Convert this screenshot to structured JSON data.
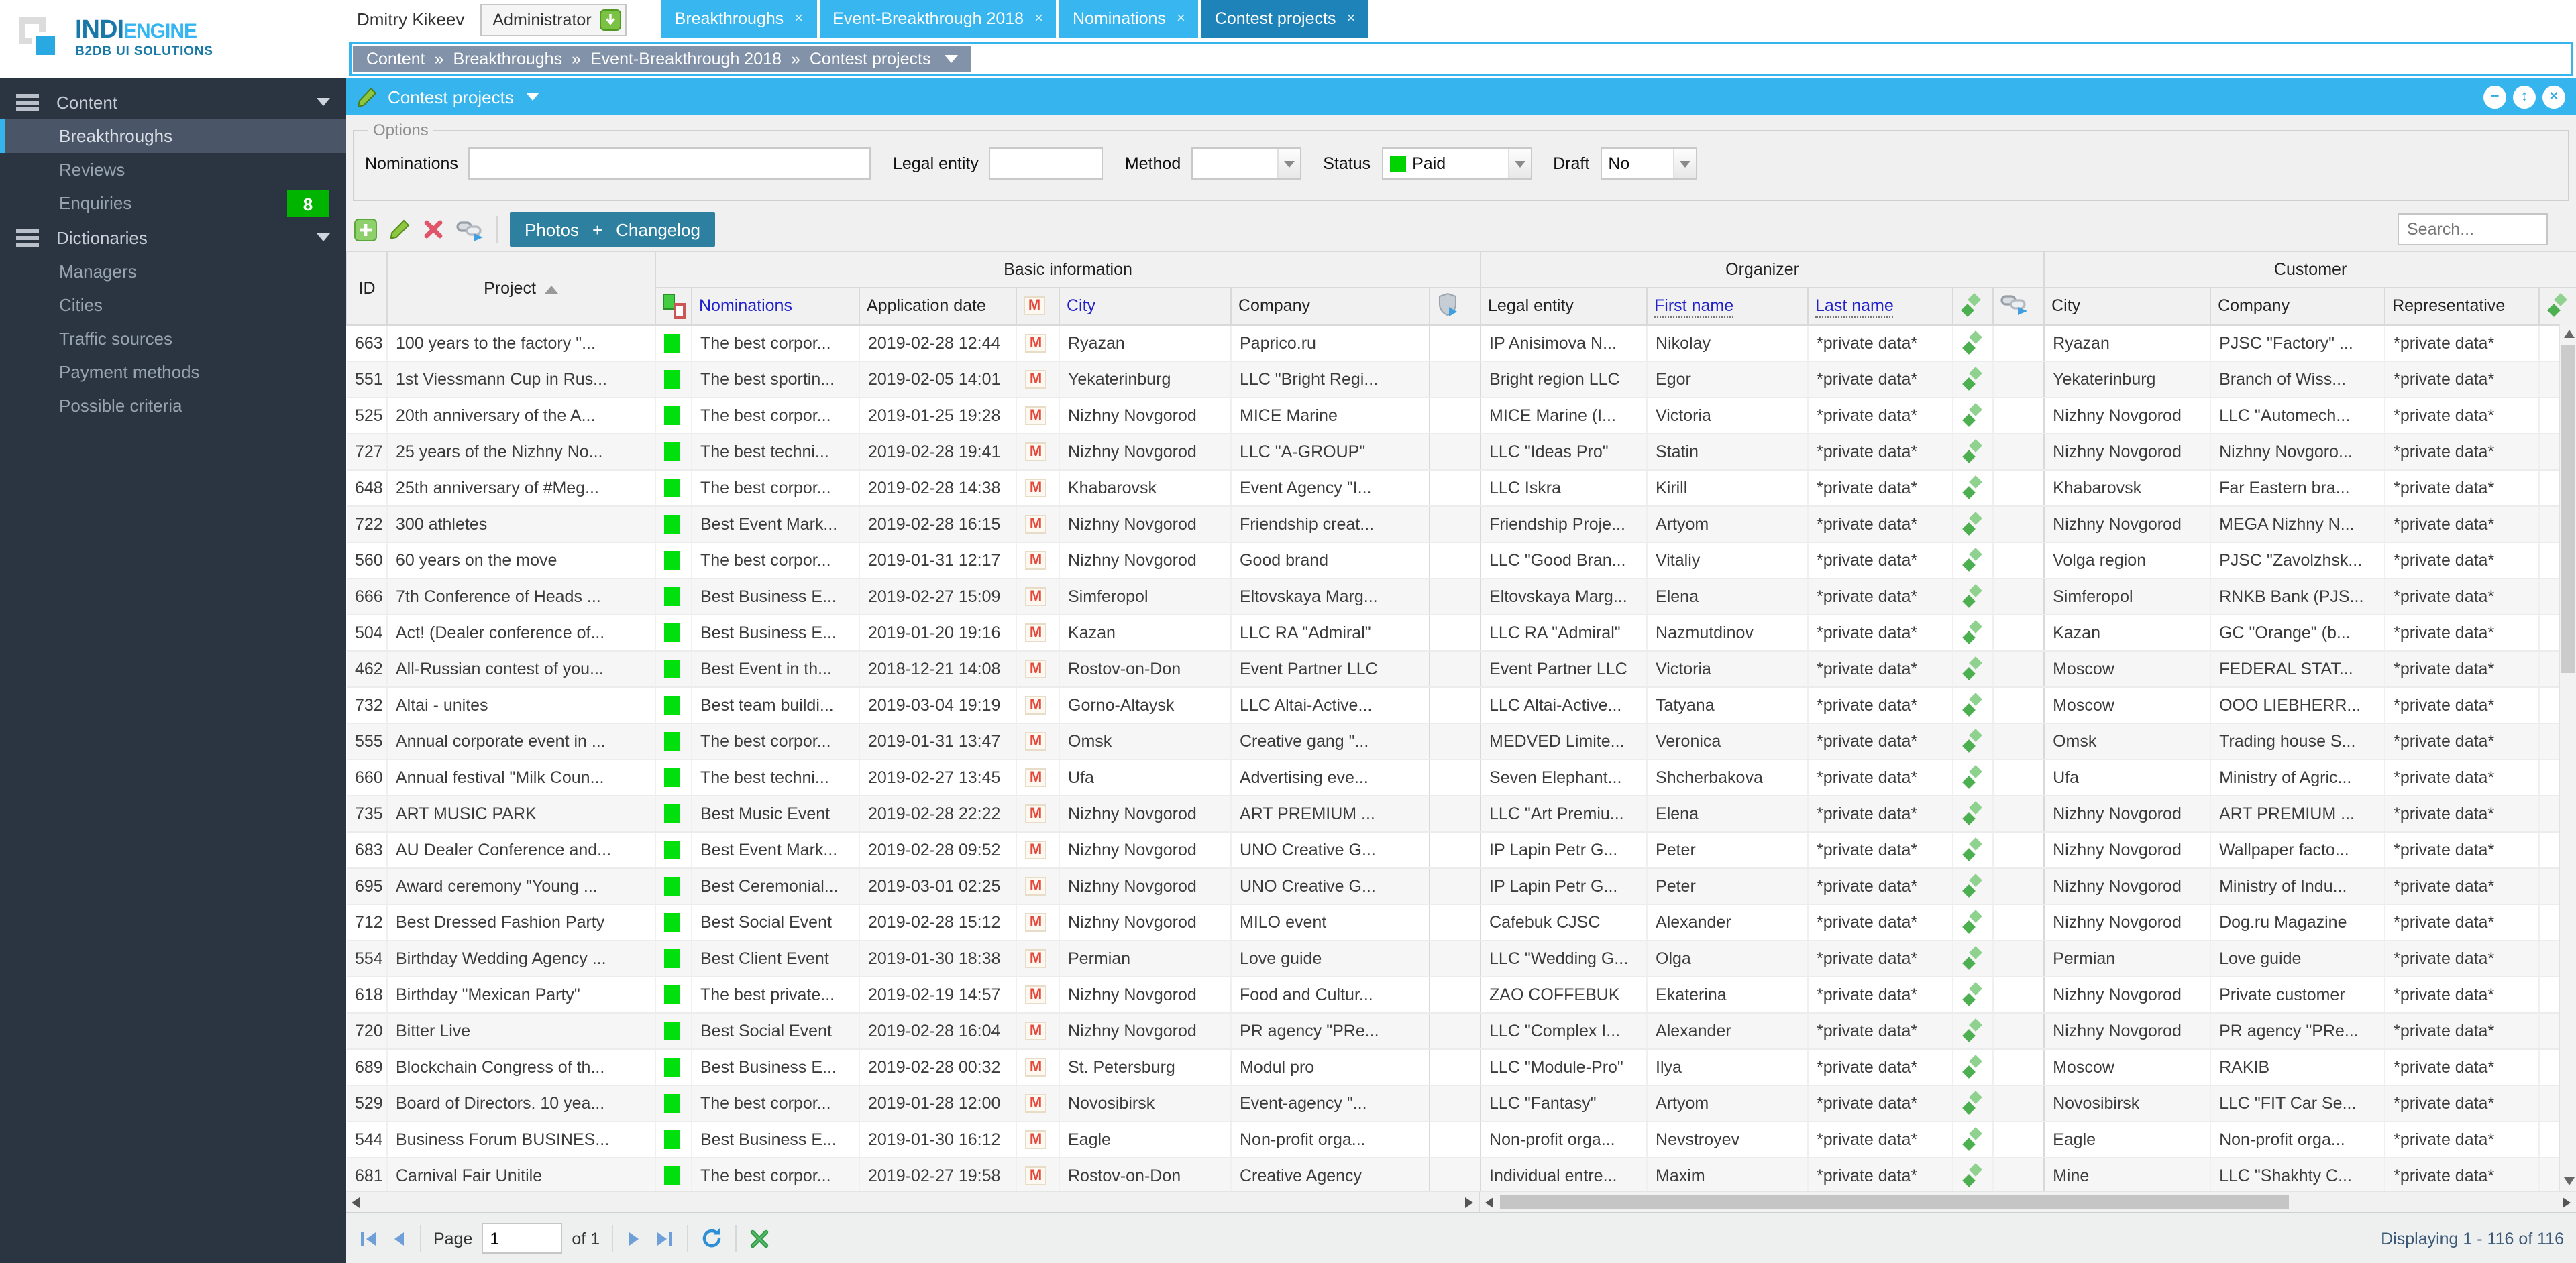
{
  "logo": {
    "line1a": "INDI",
    "line1b": "ENGINE",
    "line2": "B2DB UI SOLUTIONS"
  },
  "header": {
    "user_name": "Dmitry Kikeev",
    "user_role": "Administrator",
    "tabs": [
      {
        "label": "Breakthroughs",
        "active": false
      },
      {
        "label": "Event-Breakthrough 2018",
        "active": false
      },
      {
        "label": "Nominations",
        "active": false
      },
      {
        "label": "Contest projects",
        "active": true
      }
    ],
    "tab_close_glyph": "×",
    "breadcrumb": {
      "separator": "»",
      "items": [
        "Content",
        "Breakthroughs",
        "Event-Breakthrough 2018",
        "Contest projects"
      ]
    }
  },
  "sidebar": {
    "items": [
      {
        "label": "Content",
        "type": "section"
      },
      {
        "label": "Breakthroughs",
        "type": "child",
        "selected": true
      },
      {
        "label": "Reviews",
        "type": "child"
      },
      {
        "label": "Enquiries",
        "type": "child",
        "badge": "8"
      },
      {
        "label": "Dictionaries",
        "type": "section"
      },
      {
        "label": "Managers",
        "type": "child"
      },
      {
        "label": "Cities",
        "type": "child"
      },
      {
        "label": "Traffic sources",
        "type": "child"
      },
      {
        "label": "Payment methods",
        "type": "child"
      },
      {
        "label": "Possible criteria",
        "type": "child"
      }
    ]
  },
  "panel": {
    "title": "Contest projects",
    "collapse_glyph": "−",
    "expand_glyph": "↕",
    "close_glyph": "×"
  },
  "options": {
    "legend": "Options",
    "nominations_label": "Nominations",
    "nominations_value": "",
    "legal_label": "Legal entity",
    "legal_value": "",
    "method_label": "Method",
    "method_value": "",
    "status_label": "Status",
    "status_value": "Paid",
    "status_color": "#00d400",
    "draft_label": "Draft",
    "draft_value": "No"
  },
  "toolbar": {
    "photos_label": "Photos",
    "plus_label": "+",
    "changelog_label": "Changelog",
    "search_placeholder": "Search..."
  },
  "grid": {
    "groups": [
      "Basic information",
      "Organizer",
      "Customer"
    ],
    "columns": [
      "ID",
      "Project",
      "Nominations",
      "Application date",
      "City",
      "Company",
      "Legal entity",
      "First name",
      "Last name",
      "City",
      "Company",
      "Representative"
    ],
    "sort_column": "Project",
    "private_label": "*private data*",
    "rows": [
      [
        "663",
        "100 years to the factory \"...",
        "The best corpor...",
        "2019-02-28 12:44",
        "Ryazan",
        "Paprico.ru",
        "IP Anisimova N...",
        "Nikolay",
        "*private data*",
        "Ryazan",
        "PJSC \"Factory\" ...",
        "*private data*"
      ],
      [
        "551",
        "1st Viessmann Cup in Rus...",
        "The best sportin...",
        "2019-02-05 14:01",
        "Yekaterinburg",
        "LLC \"Bright Regi...",
        "Bright region LLC",
        "Egor",
        "*private data*",
        "Yekaterinburg",
        "Branch of Wiss...",
        "*private data*"
      ],
      [
        "525",
        "20th anniversary of the A...",
        "The best corpor...",
        "2019-01-25 19:28",
        "Nizhny Novgorod",
        "MICE Marine",
        "MICE Marine (I...",
        "Victoria",
        "*private data*",
        "Nizhny Novgorod",
        "LLC \"Automech...",
        "*private data*"
      ],
      [
        "727",
        "25 years of the Nizhny No...",
        "The best techni...",
        "2019-02-28 19:41",
        "Nizhny Novgorod",
        "LLC \"A-GROUP\"",
        "LLC \"Ideas Pro\"",
        "Statin",
        "*private data*",
        "Nizhny Novgorod",
        "Nizhny Novgoro...",
        "*private data*"
      ],
      [
        "648",
        "25th anniversary of #Meg...",
        "The best corpor...",
        "2019-02-28 14:38",
        "Khabarovsk",
        "Event Agency \"I...",
        "LLC Iskra",
        "Kirill",
        "*private data*",
        "Khabarovsk",
        "Far Eastern bra...",
        "*private data*"
      ],
      [
        "722",
        "300 athletes",
        "Best Event Mark...",
        "2019-02-28 16:15",
        "Nizhny Novgorod",
        "Friendship creat...",
        "Friendship Proje...",
        "Artyom",
        "*private data*",
        "Nizhny Novgorod",
        "MEGA Nizhny N...",
        "*private data*"
      ],
      [
        "560",
        "60 years on the move",
        "The best corpor...",
        "2019-01-31 12:17",
        "Nizhny Novgorod",
        "Good brand",
        "LLC \"Good Bran...",
        "Vitaliy",
        "*private data*",
        "Volga region",
        "PJSC \"Zavolzhsk...",
        "*private data*"
      ],
      [
        "666",
        "7th Conference of Heads ...",
        "Best Business E...",
        "2019-02-27 15:09",
        "Simferopol",
        "Eltovskaya Marg...",
        "Eltovskaya Marg...",
        "Elena",
        "*private data*",
        "Simferopol",
        "RNKB Bank (PJS...",
        "*private data*"
      ],
      [
        "504",
        "Act! (Dealer conference of...",
        "Best Business E...",
        "2019-01-20 19:16",
        "Kazan",
        "LLC RA \"Admiral\"",
        "LLC RA \"Admiral\"",
        "Nazmutdinov",
        "*private data*",
        "Kazan",
        "GC \"Orange\" (b...",
        "*private data*"
      ],
      [
        "462",
        "All-Russian contest of you...",
        "Best Event in th...",
        "2018-12-21 14:08",
        "Rostov-on-Don",
        "Event Partner LLC",
        "Event Partner LLC",
        "Victoria",
        "*private data*",
        "Moscow",
        "FEDERAL STAT...",
        "*private data*"
      ],
      [
        "732",
        "Altai - unites",
        "Best team buildi...",
        "2019-03-04 19:19",
        "Gorno-Altaysk",
        "LLC Altai-Active...",
        "LLC Altai-Active...",
        "Tatyana",
        "*private data*",
        "Moscow",
        "OOO LIEBHERR...",
        "*private data*"
      ],
      [
        "555",
        "Annual corporate event in ...",
        "The best corpor...",
        "2019-01-31 13:47",
        "Omsk",
        "Creative gang \"...",
        "MEDVED Limite...",
        "Veronica",
        "*private data*",
        "Omsk",
        "Trading house S...",
        "*private data*"
      ],
      [
        "660",
        "Annual festival \"Milk Coun...",
        "The best techni...",
        "2019-02-27 13:45",
        "Ufa",
        "Advertising eve...",
        "Seven Elephant...",
        "Shcherbakova",
        "*private data*",
        "Ufa",
        "Ministry of Agric...",
        "*private data*"
      ],
      [
        "735",
        "ART MUSIC PARK",
        "Best Music Event",
        "2019-02-28 22:22",
        "Nizhny Novgorod",
        "ART PREMIUM ...",
        "LLC \"Art Premiu...",
        "Elena",
        "*private data*",
        "Nizhny Novgorod",
        "ART PREMIUM ...",
        "*private data*"
      ],
      [
        "683",
        "AU Dealer Conference and...",
        "Best Event Mark...",
        "2019-02-28 09:52",
        "Nizhny Novgorod",
        "UNO Creative G...",
        "IP Lapin Petr G...",
        "Peter",
        "*private data*",
        "Nizhny Novgorod",
        "Wallpaper facto...",
        "*private data*"
      ],
      [
        "695",
        "Award ceremony \"Young ...",
        "Best Ceremonial...",
        "2019-03-01 02:25",
        "Nizhny Novgorod",
        "UNO Creative G...",
        "IP Lapin Petr G...",
        "Peter",
        "*private data*",
        "Nizhny Novgorod",
        "Ministry of Indu...",
        "*private data*"
      ],
      [
        "712",
        "Best Dressed Fashion Party",
        "Best Social Event",
        "2019-02-28 15:12",
        "Nizhny Novgorod",
        "MILO event",
        "Cafebuk CJSC",
        "Alexander",
        "*private data*",
        "Nizhny Novgorod",
        "Dog.ru Magazine",
        "*private data*"
      ],
      [
        "554",
        "Birthday Wedding Agency ...",
        "Best Client Event",
        "2019-01-30 18:38",
        "Permian",
        "Love guide",
        "LLC \"Wedding G...",
        "Olga",
        "*private data*",
        "Permian",
        "Love guide",
        "*private data*"
      ],
      [
        "618",
        "Birthday \"Mexican Party\"",
        "The best private...",
        "2019-02-19 14:57",
        "Nizhny Novgorod",
        "Food and Cultur...",
        "ZAO COFFEBUK",
        "Ekaterina",
        "*private data*",
        "Nizhny Novgorod",
        "Private customer",
        "*private data*"
      ],
      [
        "720",
        "Bitter Live",
        "Best Social Event",
        "2019-02-28 16:04",
        "Nizhny Novgorod",
        "PR agency \"PRe...",
        "LLC \"Complex I...",
        "Alexander",
        "*private data*",
        "Nizhny Novgorod",
        "PR agency \"PRe...",
        "*private data*"
      ],
      [
        "689",
        "Blockchain Congress of th...",
        "Best Business E...",
        "2019-02-28 00:32",
        "St. Petersburg",
        "Modul pro",
        "LLC \"Module-Pro\"",
        "Ilya",
        "*private data*",
        "Moscow",
        "RAKIB",
        "*private data*"
      ],
      [
        "529",
        "Board of Directors. 10 yea...",
        "The best corpor...",
        "2019-01-28 12:00",
        "Novosibirsk",
        "Event-agency \"...",
        "LLC \"Fantasy\"",
        "Artyom",
        "*private data*",
        "Novosibirsk",
        "LLC \"FIT Car Se...",
        "*private data*"
      ],
      [
        "544",
        "Business Forum BUSINES...",
        "Best Business E...",
        "2019-01-30 16:12",
        "Eagle",
        "Non-profit orga...",
        "Non-profit orga...",
        "Nevstroyev",
        "*private data*",
        "Eagle",
        "Non-profit orga...",
        "*private data*"
      ],
      [
        "681",
        "Carnival Fair Unitile",
        "The best corpor...",
        "2019-02-27 19:58",
        "Rostov-on-Don",
        "Creative Agency",
        "Individual entre...",
        "Maxim",
        "*private data*",
        "Mine",
        "LLC \"Shakhty C...",
        "*private data*"
      ]
    ]
  },
  "footer": {
    "page_label": "Page",
    "page_value": "1",
    "of_label": "of 1",
    "displaying": "Displaying 1 - 116 of 116"
  }
}
